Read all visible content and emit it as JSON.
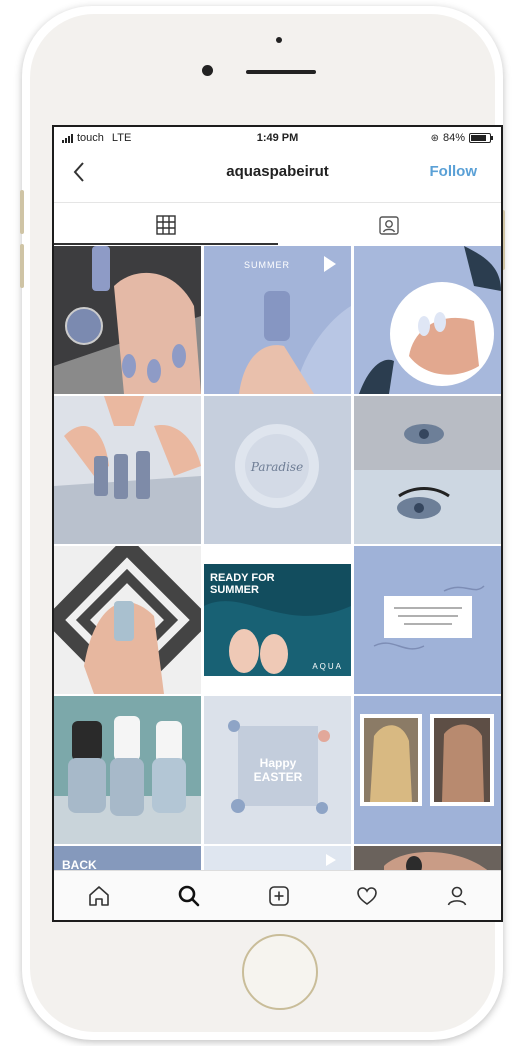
{
  "status_bar": {
    "carrier": "touch",
    "network": "LTE",
    "time": "1:49 PM",
    "battery": "84%"
  },
  "header": {
    "back_icon": "chevron-left-icon",
    "username": "aquaspabeirut",
    "follow_label": "Follow"
  },
  "tabs": [
    {
      "icon": "grid-icon",
      "active": true
    },
    {
      "icon": "tagged-person-icon",
      "active": false
    }
  ],
  "posts": [
    {
      "text": ""
    },
    {
      "text": "SUMMER"
    },
    {
      "text": ""
    },
    {
      "text": ""
    },
    {
      "text": "Paradise"
    },
    {
      "text": ""
    },
    {
      "text": ""
    },
    {
      "text": "READY FOR SUMMER",
      "brand": "AQUA"
    },
    {
      "text": ""
    },
    {
      "text": ""
    },
    {
      "text": "Happy EASTER"
    },
    {
      "text": ""
    },
    {
      "text": "BACK"
    },
    {
      "text": ""
    },
    {
      "text": ""
    }
  ],
  "bottom_nav": [
    {
      "icon": "home-icon"
    },
    {
      "icon": "search-icon",
      "active": true
    },
    {
      "icon": "add-post-icon"
    },
    {
      "icon": "heart-icon"
    },
    {
      "icon": "profile-icon"
    }
  ],
  "colors": {
    "follow_blue": "#5aa0d6",
    "tile_blue": "#9fb2d8",
    "phone_gold": "#d9cfb4"
  }
}
